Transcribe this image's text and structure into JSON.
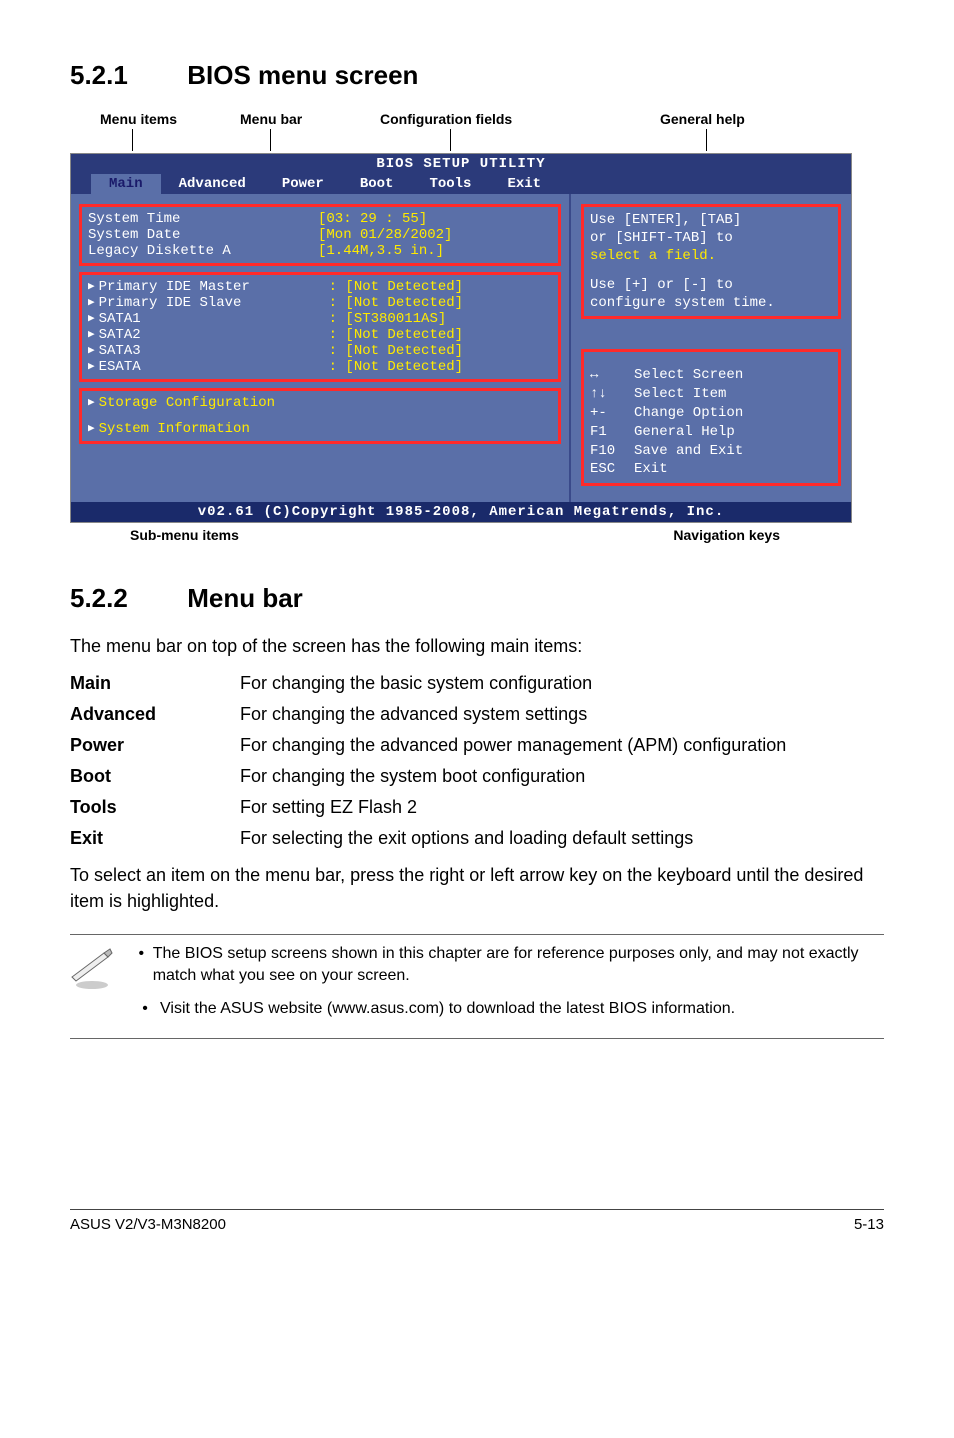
{
  "sec1": {
    "num": "5.2.1",
    "title": "BIOS menu screen"
  },
  "sec2": {
    "num": "5.2.2",
    "title": "Menu bar"
  },
  "diagram_labels": {
    "menu_items": "Menu items",
    "menu_bar": "Menu bar",
    "config_fields": "Configuration fields",
    "general_help": "General help",
    "sub_menu": "Sub-menu items",
    "nav_keys": "Navigation keys"
  },
  "bios": {
    "title": "BIOS SETUP UTILITY",
    "tabs": [
      "Main",
      "Advanced",
      "Power",
      "Boot",
      "Tools",
      "Exit"
    ],
    "left_block1": [
      {
        "k": "System Time",
        "v": "[03: 29 : 55]"
      },
      {
        "k": "System Date",
        "v": "[Mon 01/28/2002]"
      },
      {
        "k": "Legacy Diskette A",
        "v": "[1.44M,3.5 in.]"
      }
    ],
    "left_block2": [
      {
        "k": "Primary IDE Master",
        "tri": true,
        "v": ":  [Not Detected]"
      },
      {
        "k": "Primary IDE Slave",
        "tri": true,
        "v": ":  [Not Detected]"
      },
      {
        "k": "SATA1",
        "tri": true,
        "v": ":  [ST380011AS]"
      },
      {
        "k": "SATA2",
        "tri": true,
        "v": ":  [Not Detected]"
      },
      {
        "k": "SATA3",
        "tri": true,
        "v": ":  [Not Detected]"
      },
      {
        "k": "ESATA",
        "tri": true,
        "v": ":  [Not Detected]"
      }
    ],
    "left_block3": [
      {
        "k": "Storage Configuration",
        "tri": true
      },
      {
        "k": "System Information",
        "tri": true
      }
    ],
    "help_top_lines": [
      "Use [ENTER], [TAB]",
      "or [SHIFT-TAB] to",
      "select a field.",
      "",
      "Use [+] or [-] to",
      "configure system time."
    ],
    "help_keys": [
      {
        "k": "↔",
        "v": "Select Screen"
      },
      {
        "k": "↑↓",
        "v": "Select Item"
      },
      {
        "k": "+-",
        "v": "Change Option"
      },
      {
        "k": "F1",
        "v": "General Help"
      },
      {
        "k": "F10",
        "v": "Save and Exit"
      },
      {
        "k": "ESC",
        "v": "Exit"
      }
    ],
    "footer": "v02.61 (C)Copyright 1985-2008, American Megatrends, Inc."
  },
  "menubar_intro": "The menu bar on top of the screen has the following main items:",
  "defs": [
    {
      "k": "Main",
      "v": "For changing the basic system configuration"
    },
    {
      "k": "Advanced",
      "v": "For changing the advanced system settings"
    },
    {
      "k": "Power",
      "v": "For changing the advanced power management (APM) configuration"
    },
    {
      "k": "Boot",
      "v": "For changing the system boot configuration"
    },
    {
      "k": "Tools",
      "v": "For setting EZ Flash 2"
    },
    {
      "k": "Exit",
      "v": "For selecting the exit options and loading default settings"
    }
  ],
  "select_text": "To select an item on the menu bar, press the right or left arrow key on the keyboard until the desired item is highlighted.",
  "notes": [
    "The BIOS setup screens shown in this chapter are for reference purposes only, and may not exactly match what you see on your screen.",
    "Visit the ASUS website (www.asus.com) to download the latest BIOS information."
  ],
  "footer": {
    "left": "ASUS V2/V3-M3N8200",
    "right": "5-13"
  }
}
